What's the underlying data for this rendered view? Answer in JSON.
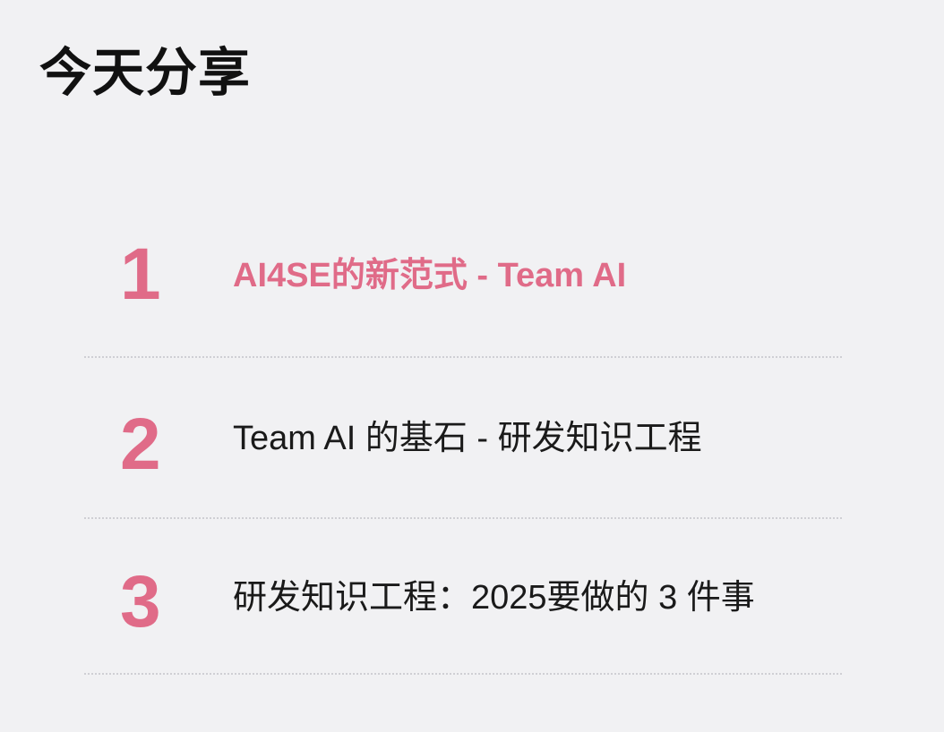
{
  "title": "今天分享",
  "accent_color": "#e06b88",
  "agenda": [
    {
      "number": "1",
      "label": "AI4SE的新范式 - Team AI",
      "highlighted": true
    },
    {
      "number": "2",
      "label": "Team AI 的基石 - 研发知识工程",
      "highlighted": false
    },
    {
      "number": "3",
      "label": "研发知识工程：2025要做的 3 件事",
      "highlighted": false
    }
  ]
}
